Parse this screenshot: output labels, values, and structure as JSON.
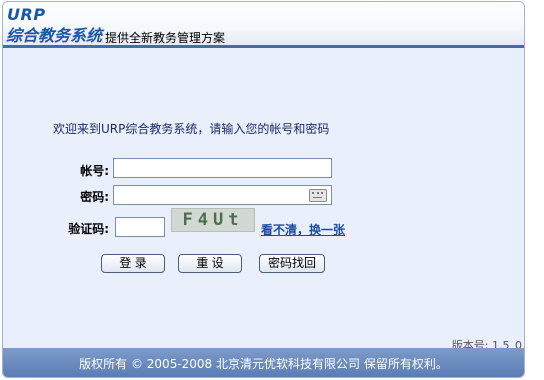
{
  "header": {
    "logo_top": "URP",
    "logo_main": "综合教务系统",
    "tagline": "提供全新教务管理方案"
  },
  "login": {
    "welcome": "欢迎来到URP综合教务系统，请输入您的帐号和密码",
    "account_label": "帐号:",
    "account_value": "",
    "password_label": "密码:",
    "password_value": "",
    "captcha_label": "验证码:",
    "captcha_value": "",
    "captcha_text": "F4Ut",
    "refresh_link": "看不清，换一张",
    "buttons": {
      "login": "登 录",
      "reset": "重 设",
      "recover": "密码找回"
    }
  },
  "version": "版本号: 1.5_0",
  "footer": {
    "copyright": "版权所有 © 2005-2008 北京清元优软科技有限公司 保留所有权利。"
  },
  "colors": {
    "accent": "#3c6fb0",
    "content_bg": "#e9effb",
    "link": "#1e4ba8"
  }
}
